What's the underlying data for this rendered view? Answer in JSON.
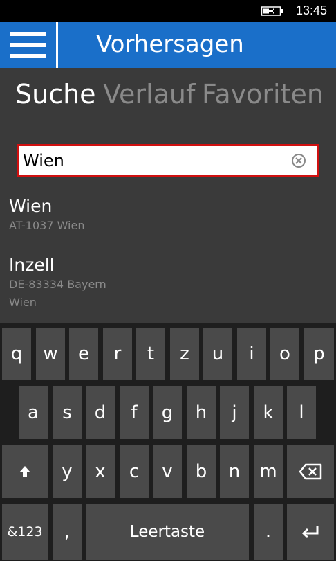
{
  "status": {
    "time": "13:45",
    "battery_icon": "battery-charging-icon"
  },
  "header": {
    "menu_icon": "hamburger-menu-icon",
    "title": "Vorhersagen"
  },
  "tabs": [
    {
      "label": "Suche",
      "active": true
    },
    {
      "label": "Verlauf",
      "active": false
    },
    {
      "label": "Favoriten",
      "active": false
    }
  ],
  "search": {
    "value": "Wien",
    "placeholder": "",
    "clear_icon": "clear-circle-icon"
  },
  "results": [
    {
      "name": "Wien",
      "lines": [
        "AT-1037 Wien"
      ]
    },
    {
      "name": "Inzell",
      "lines": [
        "DE-83334 Bayern",
        "Wien"
      ]
    }
  ],
  "keyboard": {
    "row1": [
      "q",
      "w",
      "e",
      "r",
      "t",
      "z",
      "u",
      "i",
      "o",
      "p"
    ],
    "row2": [
      "a",
      "s",
      "d",
      "f",
      "g",
      "h",
      "j",
      "k",
      "l"
    ],
    "row3": [
      "y",
      "x",
      "c",
      "v",
      "b",
      "n",
      "m"
    ],
    "shift_icon": "shift-arrow-icon",
    "backspace_icon": "backspace-icon",
    "symbols_label": "&123",
    "comma_label": ",",
    "space_label": "Leertaste",
    "period_label": ".",
    "enter_icon": "enter-icon"
  },
  "colors": {
    "accent": "#1a6fc9",
    "background": "#3a3a3a",
    "search_border": "#d01010",
    "key": "#4a4a4a",
    "keyboard_bg": "#1e1e1e"
  }
}
